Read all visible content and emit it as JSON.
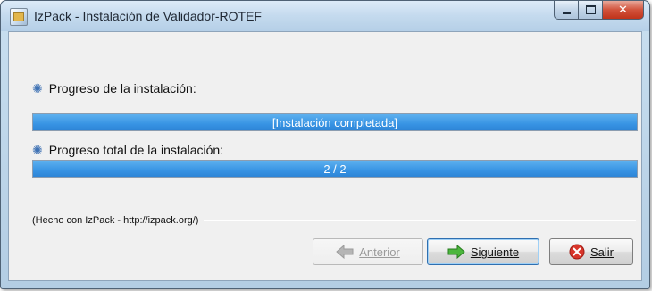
{
  "window": {
    "title": "IzPack - Instalación de Validador-ROTEF",
    "icon": "izpack-app-icon",
    "controls": {
      "minimize": "minimize-icon",
      "maximize": "maximize-icon",
      "close": "close-icon"
    }
  },
  "pack_progress": {
    "label": "Progreso de la instalación:",
    "icon": "gear-icon",
    "bar_text": "[Instalación completada]",
    "value_percent": 100
  },
  "overall_progress": {
    "label": "Progreso total de la instalación:",
    "icon": "gear-icon",
    "bar_text": "2 / 2",
    "current": 2,
    "total": 2
  },
  "footer": {
    "credit": "(Hecho con IzPack - http://izpack.org/)"
  },
  "buttons": {
    "previous": {
      "label": "Anterior",
      "icon": "arrow-left-icon",
      "enabled": false
    },
    "next": {
      "label": "Siguiente",
      "icon": "arrow-right-icon",
      "enabled": true
    },
    "quit": {
      "label": "Salir",
      "icon": "close-circle-icon",
      "enabled": true
    }
  },
  "colors": {
    "progress_fill": "#3894e4",
    "progress_text": "#ffffff",
    "next_arrow": "#39a52e",
    "quit_icon": "#d8352a",
    "disabled_text": "#9a9a9a"
  }
}
